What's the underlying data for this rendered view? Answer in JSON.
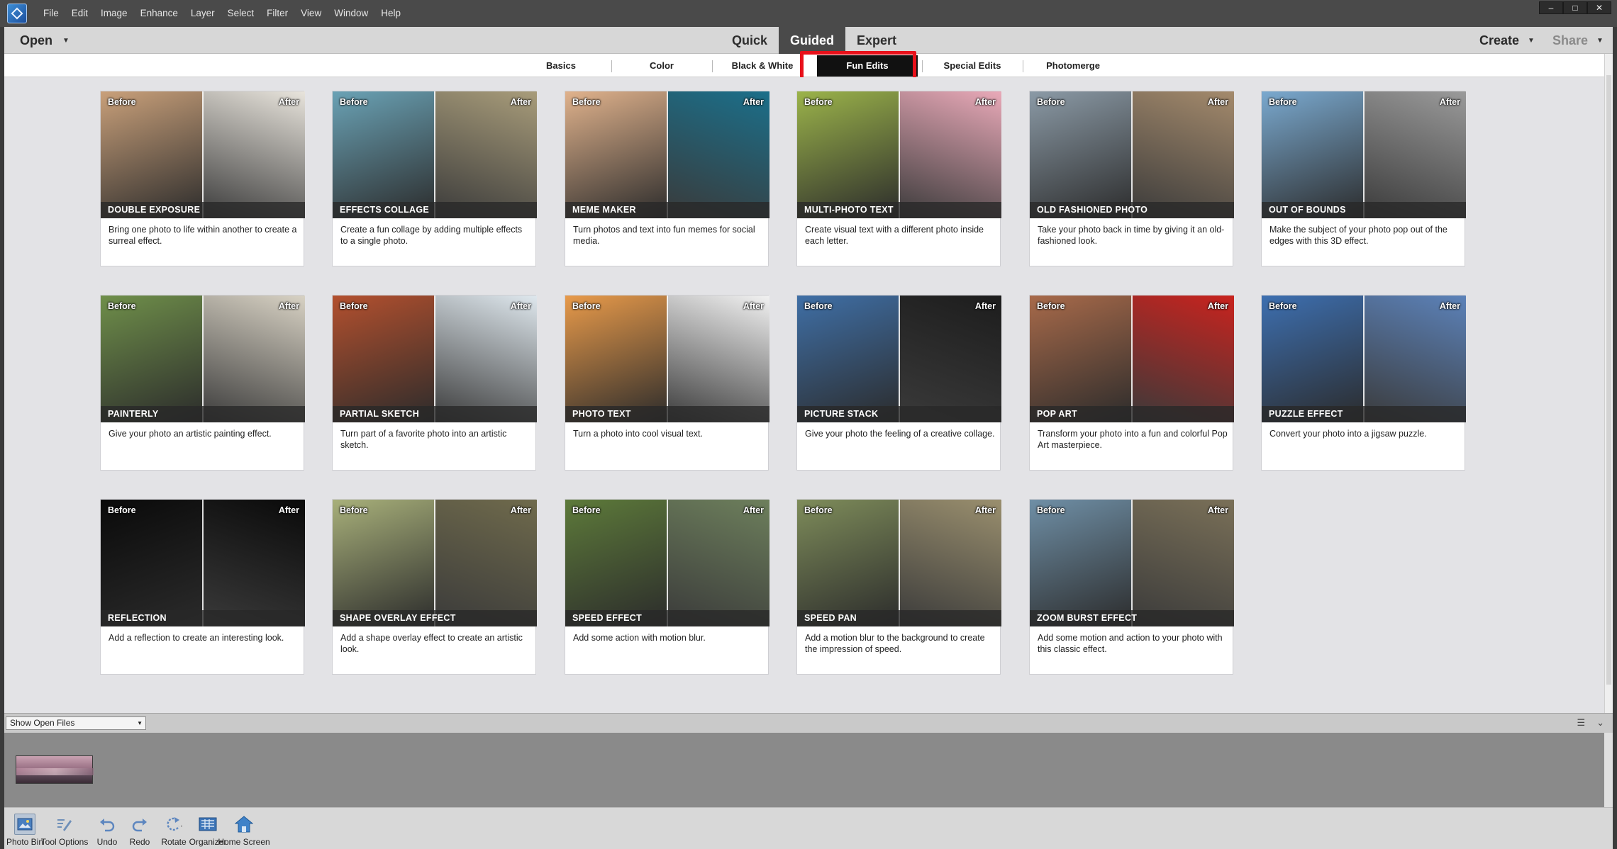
{
  "menubar": {
    "items": [
      "File",
      "Edit",
      "Image",
      "Enhance",
      "Layer",
      "Select",
      "Filter",
      "View",
      "Window",
      "Help"
    ],
    "window_controls": [
      "–",
      "□",
      "✕"
    ]
  },
  "modebar": {
    "open_label": "Open",
    "modes": [
      "Quick",
      "Guided",
      "Expert"
    ],
    "active_mode": "Guided",
    "create_label": "Create",
    "share_label": "Share"
  },
  "categories": {
    "tabs": [
      "Basics",
      "Color",
      "Black & White",
      "Fun Edits",
      "Special Edits",
      "Photomerge"
    ],
    "active": "Fun Edits"
  },
  "cards": [
    {
      "title": "DOUBLE EXPOSURE",
      "desc": "Bring one photo to life within another to create a surreal effect.",
      "before": "Before",
      "after": "After",
      "colors": [
        "#c9a07a",
        "#e8e4dc"
      ]
    },
    {
      "title": "EFFECTS COLLAGE",
      "desc": "Create a fun collage by adding multiple effects to a single photo.",
      "before": "Before",
      "after": "After",
      "colors": [
        "#6aa2b5",
        "#a89c7a"
      ]
    },
    {
      "title": "MEME MAKER",
      "desc": "Turn photos and text into fun memes for social media.",
      "before": "Before",
      "after": "After",
      "colors": [
        "#e0b28c",
        "#1b6f8a"
      ]
    },
    {
      "title": "MULTI-PHOTO TEXT",
      "desc": "Create visual text with a different photo inside each letter.",
      "before": "Before",
      "after": "After",
      "colors": [
        "#9bb34a",
        "#e9a9b8"
      ]
    },
    {
      "title": "OLD FASHIONED PHOTO",
      "desc": "Take your photo back in time by giving it an old-fashioned look.",
      "before": "Before",
      "after": "After",
      "colors": [
        "#8b9aa6",
        "#a48a6c"
      ]
    },
    {
      "title": "OUT OF BOUNDS",
      "desc": "Make the subject of your photo pop out of the edges with this 3D effect.",
      "before": "Before",
      "after": "After",
      "colors": [
        "#7aa9cf",
        "#9a9a9a"
      ]
    },
    {
      "title": "PAINTERLY",
      "desc": "Give your photo an artistic painting effect.",
      "before": "Before",
      "after": "After",
      "colors": [
        "#6f8f4a",
        "#d8d2c4"
      ]
    },
    {
      "title": "PARTIAL SKETCH",
      "desc": "Turn part of a favorite photo into an artistic sketch.",
      "before": "Before",
      "after": "After",
      "colors": [
        "#b3502e",
        "#dfe8ee"
      ]
    },
    {
      "title": "PHOTO TEXT",
      "desc": "Turn a photo into cool visual text.",
      "before": "Before",
      "after": "After",
      "colors": [
        "#e89a4a",
        "#f2f2f2"
      ]
    },
    {
      "title": "PICTURE STACK",
      "desc": "Give your photo the feeling of a creative collage.",
      "before": "Before",
      "after": "After",
      "colors": [
        "#3f6fa6",
        "#1d1d1d"
      ]
    },
    {
      "title": "POP ART",
      "desc": "Transform your photo into a fun and colorful Pop Art masterpiece.",
      "before": "Before",
      "after": "After",
      "colors": [
        "#a86a4a",
        "#c9231e"
      ]
    },
    {
      "title": "PUZZLE EFFECT",
      "desc": "Convert your photo into a jigsaw puzzle.",
      "before": "Before",
      "after": "After",
      "colors": [
        "#3d6fb0",
        "#5c82b9"
      ]
    },
    {
      "title": "REFLECTION",
      "desc": "Add a reflection to create an interesting look.",
      "before": "Before",
      "after": "After",
      "colors": [
        "#0a0a0a",
        "#0a0a0a"
      ]
    },
    {
      "title": "SHAPE OVERLAY EFFECT",
      "desc": "Add a shape overlay effect to create an artistic look.",
      "before": "Before",
      "after": "After",
      "colors": [
        "#a8b07a",
        "#6f6a4c"
      ]
    },
    {
      "title": "SPEED EFFECT",
      "desc": "Add some action with motion blur.",
      "before": "Before",
      "after": "After",
      "colors": [
        "#5d7a3a",
        "#6d7f5c"
      ]
    },
    {
      "title": "SPEED PAN",
      "desc": "Add a motion blur to the background to create the impression of speed.",
      "before": "Before",
      "after": "After",
      "colors": [
        "#7e8c5a",
        "#9a8f6e"
      ]
    },
    {
      "title": "ZOOM BURST EFFECT",
      "desc": "Add some motion and action to your photo with this classic effect.",
      "before": "Before",
      "after": "After",
      "colors": [
        "#6f8fa6",
        "#7a7058"
      ]
    }
  ],
  "bin": {
    "selector_value": "Show Open Files"
  },
  "taskbar": {
    "buttons": [
      {
        "label": "Photo Bin",
        "icon": "photo-bin-icon"
      },
      {
        "label": "Tool Options",
        "icon": "tool-options-icon"
      },
      {
        "label": "Undo",
        "icon": "undo-icon"
      },
      {
        "label": "Redo",
        "icon": "redo-icon"
      },
      {
        "label": "Rotate",
        "icon": "rotate-icon"
      },
      {
        "label": "Organizer",
        "icon": "organizer-icon"
      },
      {
        "label": "Home Screen",
        "icon": "home-icon"
      }
    ]
  }
}
